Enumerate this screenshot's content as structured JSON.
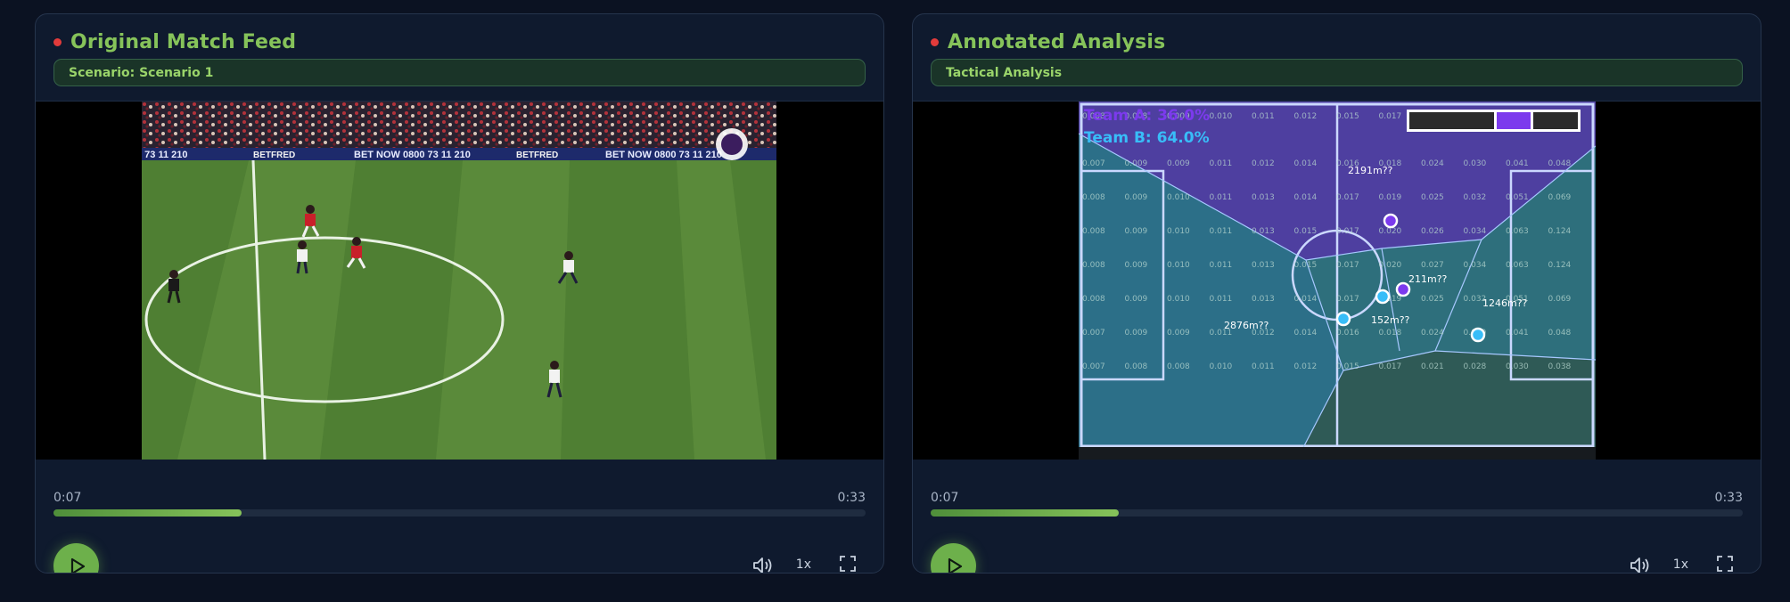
{
  "panels": [
    {
      "title": "Original Match Feed",
      "subtitle": "Scenario: Scenario 1",
      "time_current": "0:07",
      "time_total": "0:33",
      "progress": 0.232,
      "speed": "1x",
      "ad_text": "BET NOW 0800 73 11 210",
      "sponsor": "BETFRED",
      "ad_partial": "0 73 11 210"
    },
    {
      "title": "Annotated Analysis",
      "subtitle": "Tactical Analysis",
      "time_current": "0:07",
      "time_total": "0:33",
      "progress": 0.232,
      "speed": "1x"
    }
  ],
  "analysis": {
    "team_a_label": "Team A: 36.0%",
    "team_b_label": "Team B: 64.0%",
    "area_labels": [
      "2191m??",
      "211m??",
      "152m??",
      "1246m??",
      "2876m??"
    ],
    "grid_rows": [
      [
        "0.008",
        "0.008",
        "0.009",
        "0.010",
        "0.011",
        "0.012",
        "0.015",
        "0.017"
      ],
      [
        "0.007",
        "0.009",
        "0.009",
        "0.011",
        "0.012",
        "0.014",
        "0.016",
        "0.018",
        "0.024",
        "0.030",
        "0.041",
        "0.048"
      ],
      [
        "0.008",
        "0.009",
        "0.010",
        "0.011",
        "0.013",
        "0.014",
        "0.017",
        "0.019",
        "0.025",
        "0.032",
        "0.051",
        "0.069"
      ],
      [
        "0.008",
        "0.009",
        "0.010",
        "0.011",
        "0.013",
        "0.015",
        "0.017",
        "0.020",
        "0.026",
        "0.034",
        "0.063",
        "0.124"
      ],
      [
        "0.008",
        "0.009",
        "0.010",
        "0.011",
        "0.013",
        "0.015",
        "0.017",
        "0.020",
        "0.027",
        "0.034",
        "0.063",
        "0.124"
      ],
      [
        "0.008",
        "0.009",
        "0.010",
        "0.011",
        "0.013",
        "0.014",
        "0.017",
        "0.019",
        "0.025",
        "0.032",
        "0.051",
        "0.069"
      ],
      [
        "0.007",
        "0.009",
        "0.009",
        "0.011",
        "0.012",
        "0.014",
        "0.016",
        "0.018",
        "0.024",
        "0.030",
        "0.041",
        "0.048"
      ],
      [
        "0.007",
        "0.008",
        "0.008",
        "0.010",
        "0.011",
        "0.012",
        "0.015",
        "0.017",
        "0.021",
        "0.028",
        "0.030",
        "0.038"
      ]
    ]
  },
  "colors": {
    "accent": "#86c35a",
    "live": "#e23b3b",
    "team_a": "#7c3aed",
    "team_b": "#38bdf8"
  }
}
